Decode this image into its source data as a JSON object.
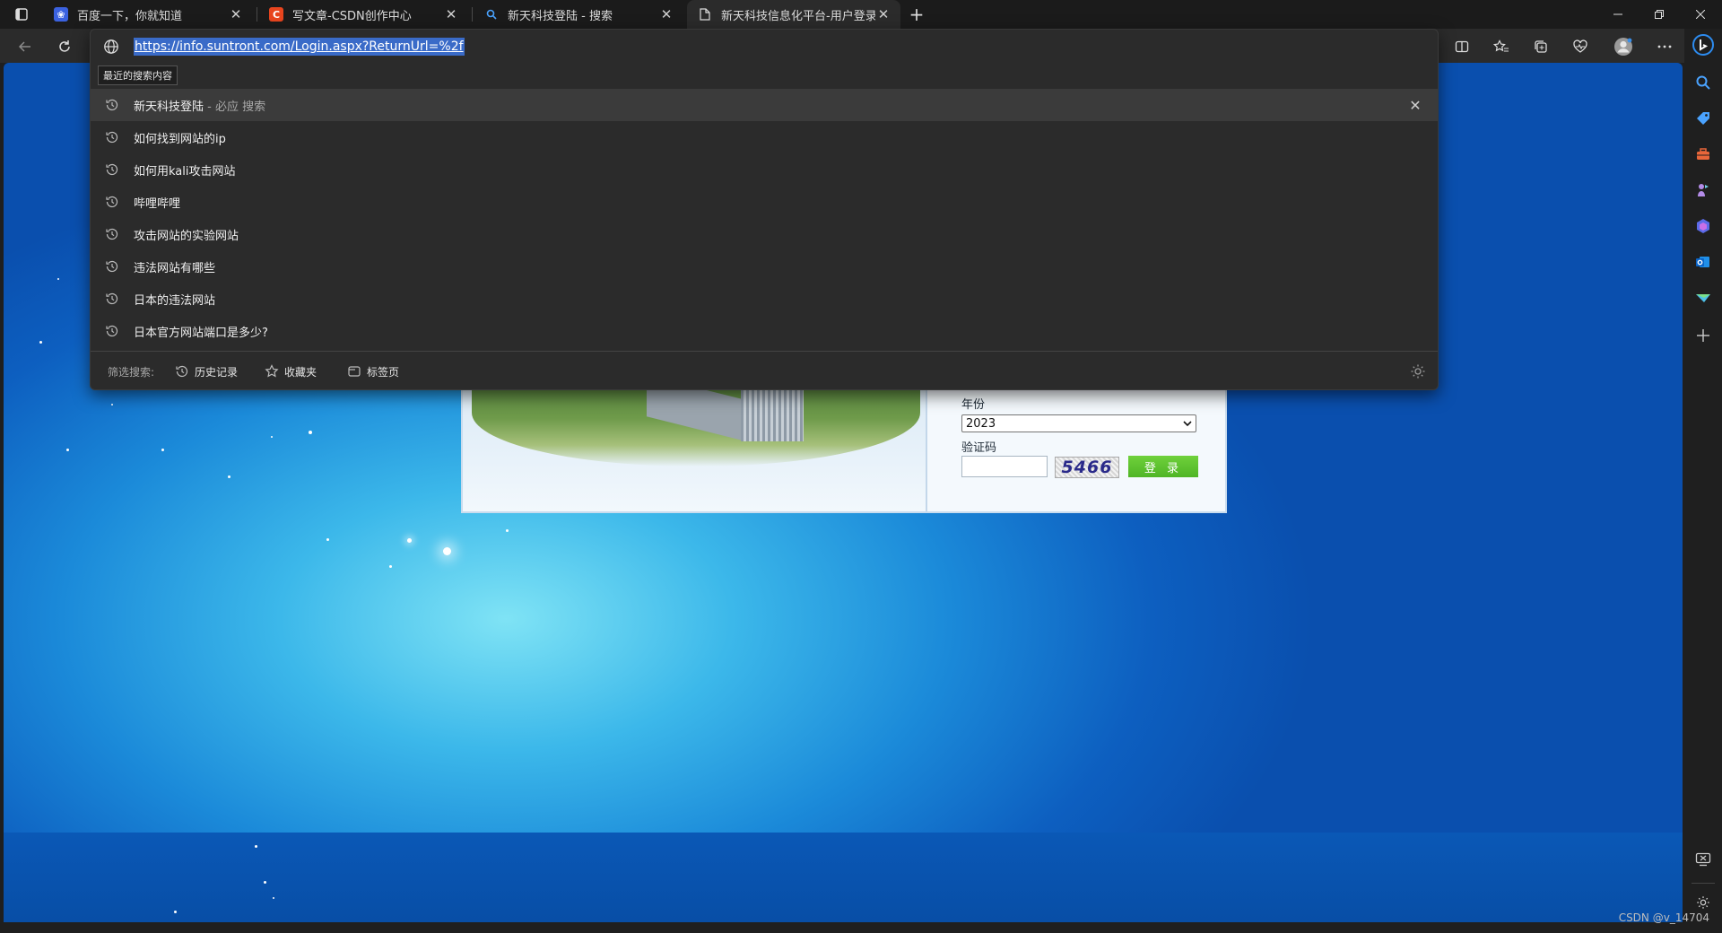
{
  "tabs": [
    {
      "title": "百度一下，你就知道",
      "favicon": "baidu-paw-icon",
      "active": false
    },
    {
      "title": "写文章-CSDN创作中心",
      "favicon": "csdn-c-icon",
      "active": false
    },
    {
      "title": "新天科技登陆 - 搜索",
      "favicon": "bing-search-icon",
      "active": false
    },
    {
      "title": "新天科技信息化平台-用户登录",
      "favicon": "page-icon",
      "active": true
    }
  ],
  "new_tab_symbol": "+",
  "address": {
    "url": "https://info.suntront.com/Login.aspx?ReturnUrl=%2f",
    "tooltip": "最近的搜索内容"
  },
  "suggestions": [
    {
      "text": "新天科技登陆",
      "suffix": " - 必应 搜索",
      "selected": true
    },
    {
      "text": "如何找到网站的ip",
      "suffix": "",
      "selected": false
    },
    {
      "text": "如何用kali攻击网站",
      "suffix": "",
      "selected": false
    },
    {
      "text": "哔哩哔哩",
      "suffix": "",
      "selected": false
    },
    {
      "text": "攻击网站的实验网站",
      "suffix": "",
      "selected": false
    },
    {
      "text": "违法网站有哪些",
      "suffix": "",
      "selected": false
    },
    {
      "text": "日本的违法网站",
      "suffix": "",
      "selected": false
    },
    {
      "text": "日本官方网站端口是多少?",
      "suffix": "",
      "selected": false
    }
  ],
  "filter": {
    "label": "筛选搜索:",
    "history": "历史记录",
    "favorites": "收藏夹",
    "tabs": "标签页"
  },
  "login": {
    "year_label": "年份",
    "year_value": "2023",
    "captcha_label": "验证码",
    "captcha_text": "5466",
    "login_button": "登 录"
  },
  "watermark": "CSDN @v_14704",
  "colors": {
    "accent_selection": "#3a6bc8",
    "login_button": "#58bd2e",
    "page_blue": "#1b8ad9"
  }
}
